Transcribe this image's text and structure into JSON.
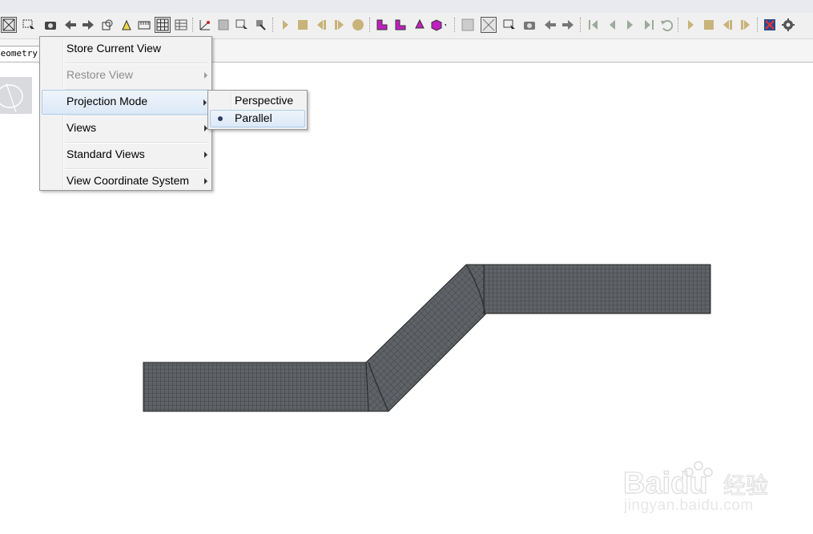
{
  "toolbar": {
    "buttons": [
      "zoom-fit-icon",
      "box-select-icon",
      "camera-icon",
      "back-arrow-icon",
      "forward-arrow-icon",
      "rotate-icon",
      "light-icon",
      "ruler-icon",
      "grid-icon",
      "table-icon",
      "axes-icon",
      "frame-icon",
      "probe-icon",
      "pick-icon",
      "play-icon",
      "stop-icon",
      "step-back-icon",
      "step-forward-icon",
      "record-icon",
      "face-select-icon",
      "edge-select-icon",
      "node-select-icon",
      "shape-select-icon",
      "fit-all-icon",
      "zoom-box-icon",
      "select-icon",
      "snapshot-icon",
      "prev-icon",
      "next-icon",
      "first-frame-icon",
      "prev-frame-icon",
      "next-frame-icon",
      "last-frame-icon",
      "undo-icon",
      "animate-icon",
      "halt-icon",
      "rewind-icon",
      "advance-icon",
      "network-icon",
      "settings-icon"
    ]
  },
  "tab": {
    "label": "Geometry S"
  },
  "context_menu": {
    "items": [
      {
        "label": "Store Current View",
        "enabled": true,
        "submenu": false
      },
      {
        "label": "Restore View",
        "enabled": false,
        "submenu": true
      },
      {
        "label": "Projection Mode",
        "enabled": true,
        "submenu": true,
        "highlighted": true
      },
      {
        "label": "Views",
        "enabled": true,
        "submenu": true
      },
      {
        "label": "Standard Views",
        "enabled": true,
        "submenu": true
      },
      {
        "label": "View Coordinate System",
        "enabled": true,
        "submenu": true
      }
    ]
  },
  "projection_submenu": {
    "items": [
      {
        "label": "Perspective",
        "selected": false
      },
      {
        "label": "Parallel",
        "selected": true
      }
    ]
  },
  "watermark": {
    "brand": "Baidu",
    "chinese": "经验",
    "url": "jingyan.baidu.com"
  },
  "colors": {
    "mesh_fill": "#5f6368",
    "mesh_line": "#2a2a2a",
    "menu_bg": "#f2f2f2",
    "highlight": "#dce9f7",
    "toolbar_bg": "#f0f0f0"
  }
}
